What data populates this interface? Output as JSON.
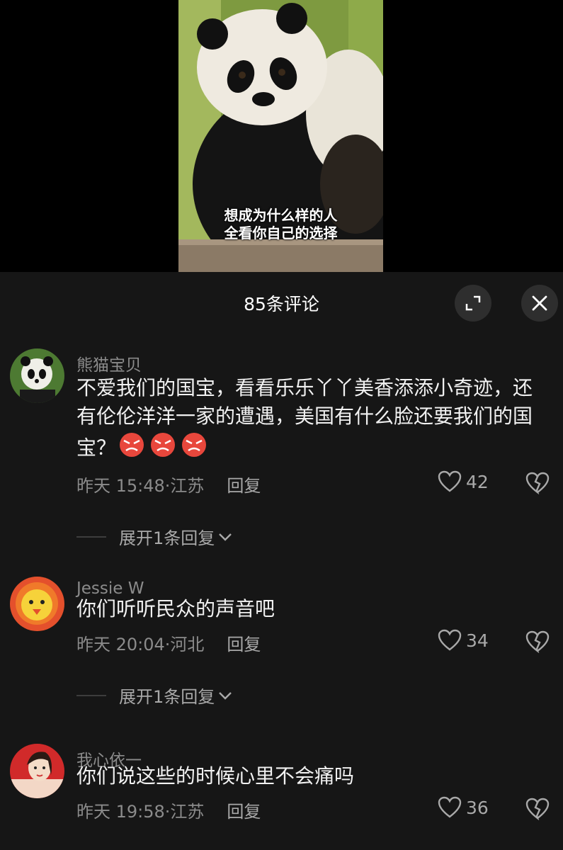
{
  "video": {
    "caption_line1": "想成为什么样的人",
    "caption_line2": "全看你自己的选择"
  },
  "header": {
    "title": "85条评论",
    "expand_icon": "expand-icon",
    "close_icon": "close-icon"
  },
  "comments": [
    {
      "username": "熊猫宝贝",
      "text": "不爱我们的国宝，看看乐乐丫丫美香添添小奇迹，还有伦伦洋洋一家的遭遇，美国有什么脸还要我们的国宝？",
      "emoji_icon": "angry-face-icon",
      "time_location": "昨天 15:48·江苏",
      "reply_label": "回复",
      "likes": "42",
      "expand_replies": "展开1条回复"
    },
    {
      "username": "Jessie W",
      "text": "你们听听民众的声音吧",
      "time_location": "昨天 20:04·河北",
      "reply_label": "回复",
      "likes": "34",
      "expand_replies": "展开1条回复"
    },
    {
      "username": "我心依一",
      "text": "你们说这些的时候心里不会痛吗",
      "time_location": "昨天 19:58·江苏",
      "reply_label": "回复",
      "likes": "36"
    }
  ],
  "colors": {
    "background": "#161616",
    "secondary_text": "#8b8b8b",
    "primary_text": "#f1f1f1"
  }
}
